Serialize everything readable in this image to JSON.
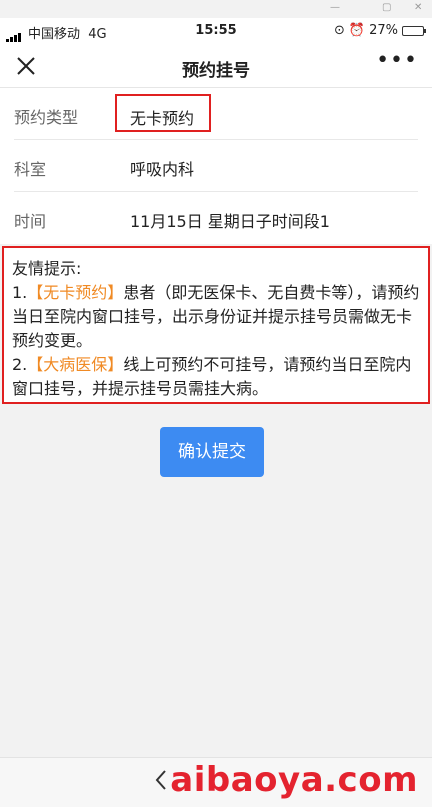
{
  "status_bar": {
    "carrier": "中国移动",
    "network": "4G",
    "time": "15:55",
    "battery": "27%",
    "battery_level": 0.27
  },
  "nav": {
    "title": "预约挂号",
    "more": "•••"
  },
  "form": {
    "rows": [
      {
        "label": "预约类型",
        "value": "无卡预约"
      },
      {
        "label": "科室",
        "value": "呼吸内科"
      },
      {
        "label": "时间",
        "value": "11月15日  星期日子时间段1"
      }
    ]
  },
  "notice": {
    "title": "友情提示:",
    "item1_prefix": "1.",
    "item1_open": "【",
    "item1_highlight": "无卡预约",
    "item1_close": "】",
    "item1_text": "患者（即无医保卡、无自费卡等），请预约当日至院内窗口挂号，出示身份证并提示挂号员需做无卡预约变更。",
    "item2_prefix": "2.",
    "item2_open": "【",
    "item2_highlight": "大病医保",
    "item2_close": "】",
    "item2_text": "线上可预约不可挂号，请预约当日至院内窗口挂号，并提示挂号员需挂大病。"
  },
  "submit_label": "确认提交",
  "watermark": "aibaoya.com",
  "colors": {
    "accent": "#3d8bf2",
    "highlight": "#f08a24",
    "annotation": "#e02020",
    "watermark": "#e4232f"
  }
}
